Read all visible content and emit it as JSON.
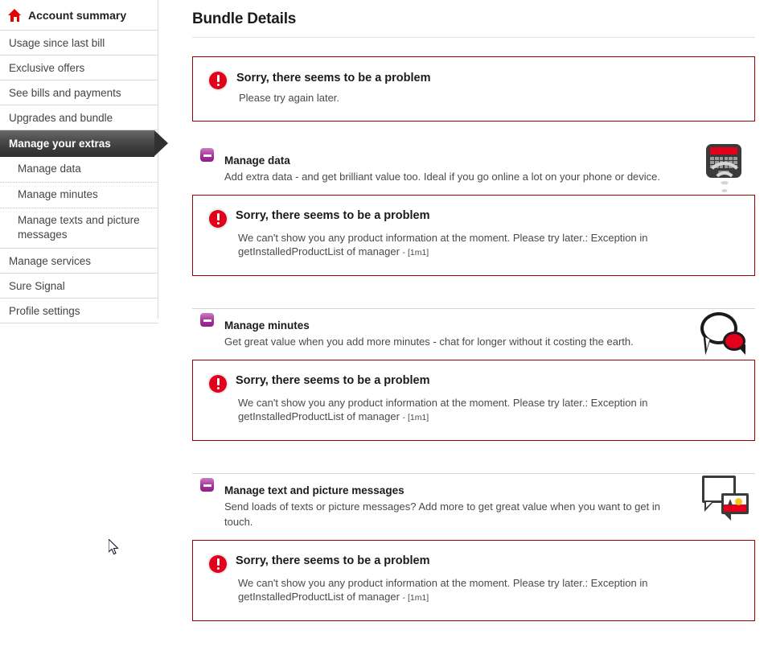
{
  "sidebar": {
    "items": [
      {
        "label": "Account summary",
        "icon": "home-icon",
        "type": "header"
      },
      {
        "label": "Usage since last bill",
        "type": "link"
      },
      {
        "label": "Exclusive offers",
        "type": "link"
      },
      {
        "label": "See bills and payments",
        "type": "link"
      },
      {
        "label": "Upgrades and bundle",
        "type": "link"
      },
      {
        "label": "Manage your extras",
        "type": "active"
      },
      {
        "label": "Manage data",
        "type": "sub"
      },
      {
        "label": "Manage minutes",
        "type": "sub"
      },
      {
        "label": "Manage texts and picture messages",
        "type": "sub"
      },
      {
        "label": "Manage services",
        "type": "link"
      },
      {
        "label": "Sure Signal",
        "type": "link"
      },
      {
        "label": "Profile settings",
        "type": "link"
      }
    ]
  },
  "main": {
    "title": "Bundle Details",
    "top_error": {
      "icon": "error-icon",
      "title": "Sorry, there seems to be a problem",
      "body": "Please try again later."
    },
    "sections": [
      {
        "toggle_icon": "minus-toggle-icon",
        "title": "Manage data",
        "description": "Add extra data - and get brilliant value too. Ideal if you go online a lot on your phone or device.",
        "art_icon": "phone-wifi-icon",
        "error": {
          "icon": "error-icon",
          "title": "Sorry, there seems to be a problem",
          "body": "We can't show you any product information at the moment. Please try later.: Exception in getInstalledProductList of manager",
          "code": "- [1m1]"
        }
      },
      {
        "toggle_icon": "minus-toggle-icon",
        "title": "Manage minutes",
        "description": "Get great value when you add more minutes - chat for longer without it costing the earth.",
        "art_icon": "speech-bubbles-icon",
        "error": {
          "icon": "error-icon",
          "title": "Sorry, there seems to be a problem",
          "body": "We can't show you any product information at the moment. Please try later.: Exception in getInstalledProductList of manager",
          "code": "- [1m1]"
        }
      },
      {
        "toggle_icon": "minus-toggle-icon",
        "title": "Manage text and picture messages",
        "description": "Send loads of texts or picture messages? Add more to get great value when you want to get in touch.",
        "art_icon": "picture-message-icon",
        "error": {
          "icon": "error-icon",
          "title": "Sorry, there seems to be a problem",
          "body": "We can't show you any product information at the moment. Please try later.: Exception in getInstalledProductList of manager",
          "code": "- [1m1]"
        }
      }
    ]
  },
  "colors": {
    "brand_red": "#e2001a",
    "error_border": "#990000",
    "toggle_purple": "#a8349b",
    "active_nav": "#3a3a3a"
  }
}
